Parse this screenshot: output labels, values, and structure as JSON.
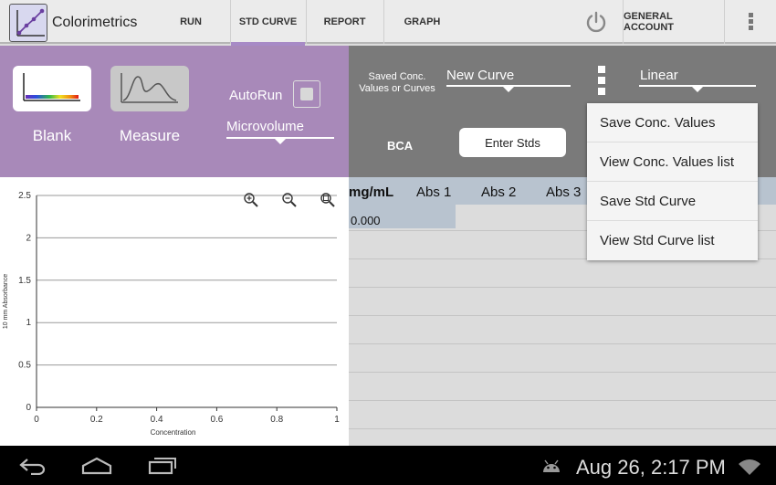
{
  "app": {
    "title": "Colorimetrics"
  },
  "tabs": [
    {
      "label": "RUN",
      "selected": false
    },
    {
      "label": "STD CURVE",
      "selected": true
    },
    {
      "label": "REPORT",
      "selected": false
    },
    {
      "label": "GRAPH",
      "selected": false
    }
  ],
  "actions": {
    "account_label": "GENERAL ACCOUNT"
  },
  "controls": {
    "blank_label": "Blank",
    "measure_label": "Measure",
    "autorun_label": "AutoRun",
    "autorun_checked": false,
    "volume_mode": "Microvolume",
    "saved_label": "Saved Conc. Values or Curves",
    "saved_value": "New Curve",
    "fit_value": "Linear",
    "assay_label": "BCA",
    "enter_stds_label": "Enter Stds"
  },
  "menu": {
    "items": [
      "Save Conc. Values",
      "View Conc. Values list",
      "Save Std Curve",
      "View Std Curve list"
    ]
  },
  "table": {
    "headers": [
      "mg/mL",
      "Abs 1",
      "Abs 2",
      "Abs 3"
    ],
    "rows": [
      {
        "conc": "0.000"
      }
    ]
  },
  "chart_data": {
    "type": "scatter",
    "title": "",
    "xlabel": "Concentration",
    "ylabel": "10 mm Absorbance",
    "xlim": [
      0,
      1
    ],
    "ylim": [
      0,
      2.5
    ],
    "x_ticks": [
      "0",
      "0.2",
      "0.4",
      "0.6",
      "0.8",
      "1"
    ],
    "y_ticks": [
      "0",
      "0.5",
      "1",
      "1.5",
      "2",
      "2.5"
    ],
    "series": [],
    "grid": true,
    "legend": "none"
  },
  "status": {
    "clock": "Aug 26, 2:17 PM"
  },
  "colors": {
    "accent": "#a78ac6",
    "control_panel": "#a889b9",
    "curve_panel": "#7a7a7a",
    "header_row": "#b8c3cf"
  }
}
